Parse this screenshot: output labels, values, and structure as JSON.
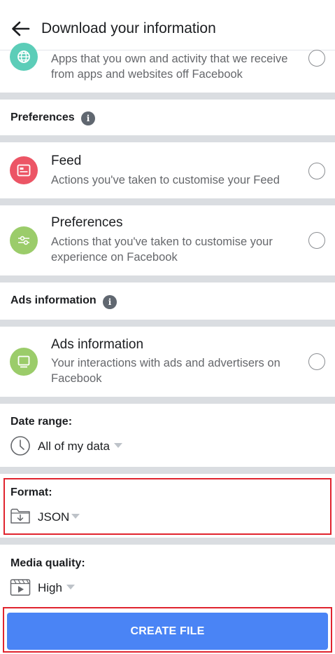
{
  "header": {
    "title": "Download your information",
    "back_icon": "arrow-left-icon"
  },
  "items": {
    "apps": {
      "icon": "globe-icon",
      "icon_color": "#5ccdb8",
      "desc": "Apps that you own and activity that we receive from apps and websites off Facebook"
    },
    "feed": {
      "icon": "feed-icon",
      "icon_color": "#ec5565",
      "title": "Feed",
      "desc": "Actions you've taken to customise your Feed"
    },
    "preferences": {
      "icon": "sliders-icon",
      "icon_color": "#9bcc6a",
      "title": "Preferences",
      "desc": "Actions that you've taken to customise your experience on Facebook"
    },
    "ads": {
      "icon": "monitor-icon",
      "icon_color": "#9bcc6a",
      "title": "Ads information",
      "desc": "Your interactions with ads and advertisers on Facebook"
    }
  },
  "sections": {
    "preferences": "Preferences",
    "ads": "Ads information",
    "info_icon_glyph": "i"
  },
  "settings": {
    "date_range": {
      "label": "Date range:",
      "value": "All of my data",
      "icon": "clock-icon"
    },
    "format": {
      "label": "Format:",
      "value": "JSON",
      "icon": "folder-download-icon"
    },
    "media_quality": {
      "label": "Media quality:",
      "value": "High",
      "icon": "video-icon"
    }
  },
  "create_button": {
    "label": "CREATE FILE",
    "color": "#4a84f5"
  },
  "highlight_color": "#e0242e"
}
